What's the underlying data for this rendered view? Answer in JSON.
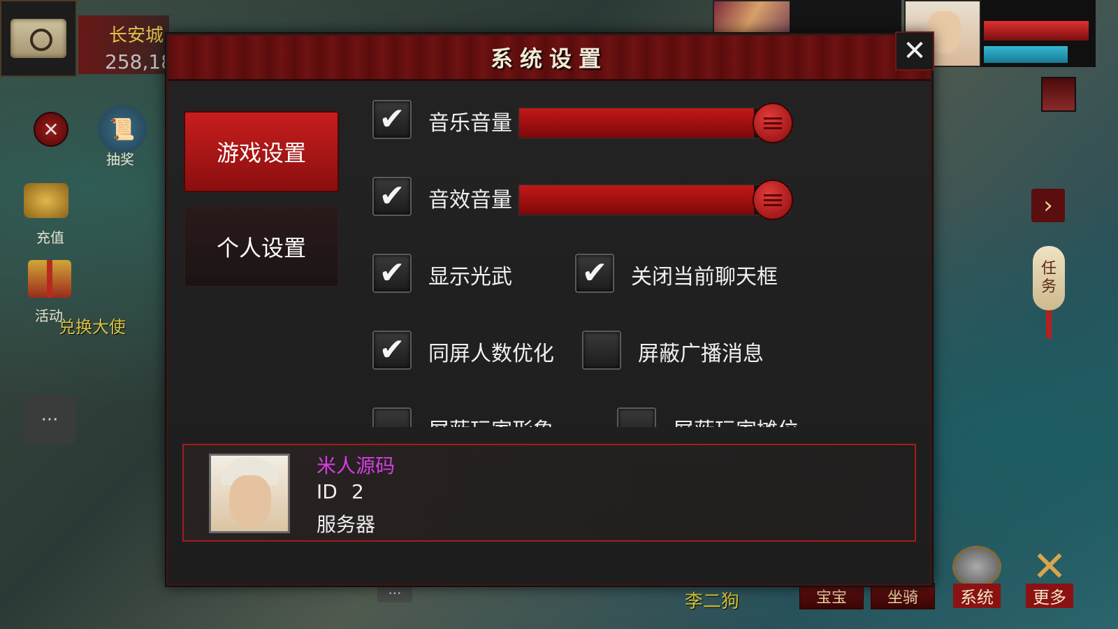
{
  "hud": {
    "city_name": "长安城",
    "coords": "258,18",
    "lottery_label": "抽奖",
    "recharge_label": "充值",
    "activity_label": "活动",
    "npc_label": "兑换大使",
    "task_label_1": "任",
    "task_label_2": "务",
    "pet_label": "宝宝",
    "mount_label": "坐骑",
    "system_label": "系统",
    "more_label": "更多",
    "player_name": "李二狗",
    "close_glyph": "✕",
    "arrow_glyph": "›",
    "chat_glyph": "···",
    "dots_glyph": "···"
  },
  "dialog": {
    "title": "系统设置",
    "close_glyph": "✕",
    "tabs": [
      {
        "label": "游戏设置",
        "active": true
      },
      {
        "label": "个人设置",
        "active": false
      }
    ],
    "sliders": [
      {
        "label": "音乐音量",
        "checked": true,
        "value_pct": 100
      },
      {
        "label": "音效音量",
        "checked": true,
        "value_pct": 100
      }
    ],
    "checkboxes": [
      {
        "label": "显示光武",
        "checked": true
      },
      {
        "label": "关闭当前聊天框",
        "checked": true
      },
      {
        "label": "同屏人数优化",
        "checked": true
      },
      {
        "label": "屏蔽广播消息",
        "checked": false
      },
      {
        "label": "屏蔽玩家形象",
        "checked": false
      },
      {
        "label": "屏蔽玩家摊位",
        "checked": false
      }
    ],
    "check_glyph": "✔"
  },
  "profile": {
    "name": "米人源码",
    "id_label": "ID",
    "id_value": "2",
    "server_label": "服务器"
  },
  "colors": {
    "accent_red": "#c81e1e",
    "profile_name": "#d43fe0",
    "gold_text": "#d8c43a"
  }
}
